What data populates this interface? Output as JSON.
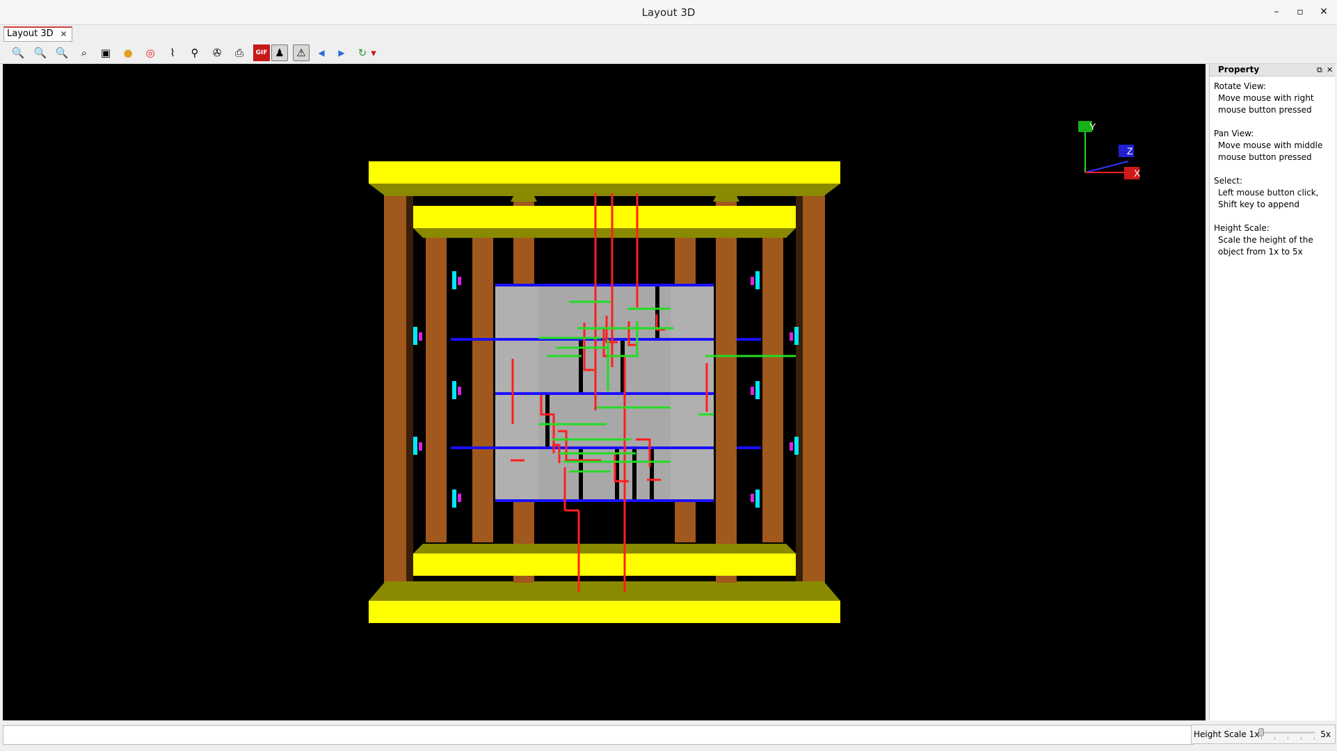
{
  "window": {
    "title": "Layout 3D",
    "buttons": {
      "minimize": "–",
      "maximize": "▫",
      "close": "✕"
    }
  },
  "tabs": [
    {
      "label": "Layout 3D",
      "close": "✕",
      "active": true
    }
  ],
  "toolbar": {
    "tools": [
      {
        "name": "zoom-in-icon",
        "glyph": "🔍"
      },
      {
        "name": "zoom-out-icon",
        "glyph": "🔍"
      },
      {
        "name": "zoom-fit-icon",
        "glyph": "🔍"
      },
      {
        "name": "binoculars-icon",
        "glyph": "⌕"
      },
      {
        "name": "zoom-area-icon",
        "glyph": "▣"
      },
      {
        "name": "sphere-icon",
        "glyph": "●"
      },
      {
        "name": "target-icon",
        "glyph": "◎"
      },
      {
        "name": "route-icon",
        "glyph": "⌇"
      },
      {
        "name": "probe-icon",
        "glyph": "⚲"
      },
      {
        "name": "film-reel-icon",
        "glyph": "✇"
      },
      {
        "name": "print-icon",
        "glyph": "⎙"
      },
      {
        "name": "gif-export-icon",
        "glyph": "GIF"
      },
      {
        "name": "person-icon",
        "glyph": "♟",
        "pressed": true
      },
      {
        "name": "warning-icon",
        "glyph": "⚠",
        "pressed": true
      },
      {
        "name": "previous-arrow-icon",
        "glyph": "◀"
      },
      {
        "name": "next-arrow-icon",
        "glyph": "▶"
      },
      {
        "name": "view-options-icon",
        "glyph": "↻"
      },
      {
        "name": "dropdown-arrow-icon",
        "glyph": "▾"
      }
    ]
  },
  "axes": {
    "y": "Y",
    "z": "Z",
    "x": "X"
  },
  "property_panel": {
    "title": "Property",
    "sections": [
      {
        "heading": "Rotate View:",
        "text": "Move mouse with right mouse button pressed"
      },
      {
        "heading": "Pan View:",
        "text": "Move mouse with middle mouse button pressed"
      },
      {
        "heading": "Select:",
        "text": "Left mouse button click, Shift key to append"
      },
      {
        "heading": "Height Scale:",
        "text": "Scale the height of the object from 1x to 5x"
      }
    ]
  },
  "statusbar": {
    "input_value": "",
    "height_scale_label": "Height Scale 1x",
    "height_scale_max": "5x",
    "height_scale_value": 1
  },
  "colors": {
    "viewport_bg": "#000000",
    "yellow": "#ffff00",
    "olive": "#8a8a00",
    "brown": "#a0581c",
    "grey_die": "#a8a8a8",
    "blue": "#1a10ff",
    "red": "#ff1e1e",
    "green": "#22dd22",
    "cyan": "#00e8ff",
    "magenta": "#e020e0"
  }
}
